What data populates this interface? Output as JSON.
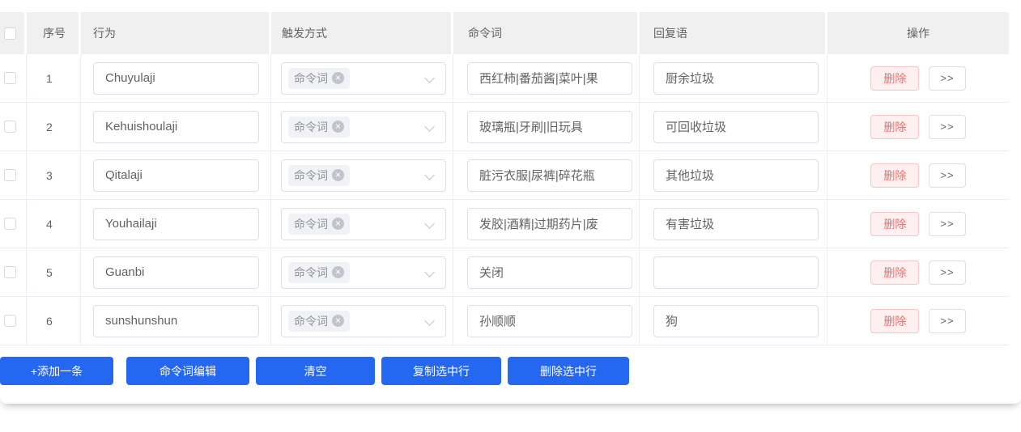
{
  "icons": {
    "tag_close": "×"
  },
  "table": {
    "headers": {
      "index": "序号",
      "behavior": "行为",
      "trigger": "触发方式",
      "command": "命令词",
      "reply": "回复语",
      "actions": "操作"
    },
    "trigger_tag": "命令词",
    "rows": [
      {
        "index": "1",
        "behavior": "Chuyulaji",
        "command": "西红柿|番茄酱|菜叶|果",
        "reply": "厨余垃圾"
      },
      {
        "index": "2",
        "behavior": "Kehuishoulaji",
        "command": "玻璃瓶|牙刷|旧玩具",
        "reply": "可回收垃圾"
      },
      {
        "index": "3",
        "behavior": "Qitalaji",
        "command": "脏污衣服|尿裤|碎花瓶",
        "reply": "其他垃圾"
      },
      {
        "index": "4",
        "behavior": "Youhailaji",
        "command": "发胶|酒精|过期药片|废",
        "reply": "有害垃圾"
      },
      {
        "index": "5",
        "behavior": "Guanbi",
        "command": "关闭",
        "reply": ""
      },
      {
        "index": "6",
        "behavior": "sunshunshun",
        "command": "孙顺顺",
        "reply": "狗"
      }
    ],
    "row_actions": {
      "delete": "删除",
      "detail": ">>"
    }
  },
  "toolbar": {
    "add": "+添加一条",
    "edit_commands": "命令词编辑",
    "clear": "清空",
    "copy_selected": "复制选中行",
    "delete_selected": "删除选中行"
  },
  "colors": {
    "primary": "#2468f2",
    "danger": "#f56c6c",
    "danger_bg": "#fef0f0",
    "header_bg": "#f0f0f0",
    "row_border": "#ebeef5",
    "input_border": "#dcdfe6"
  }
}
